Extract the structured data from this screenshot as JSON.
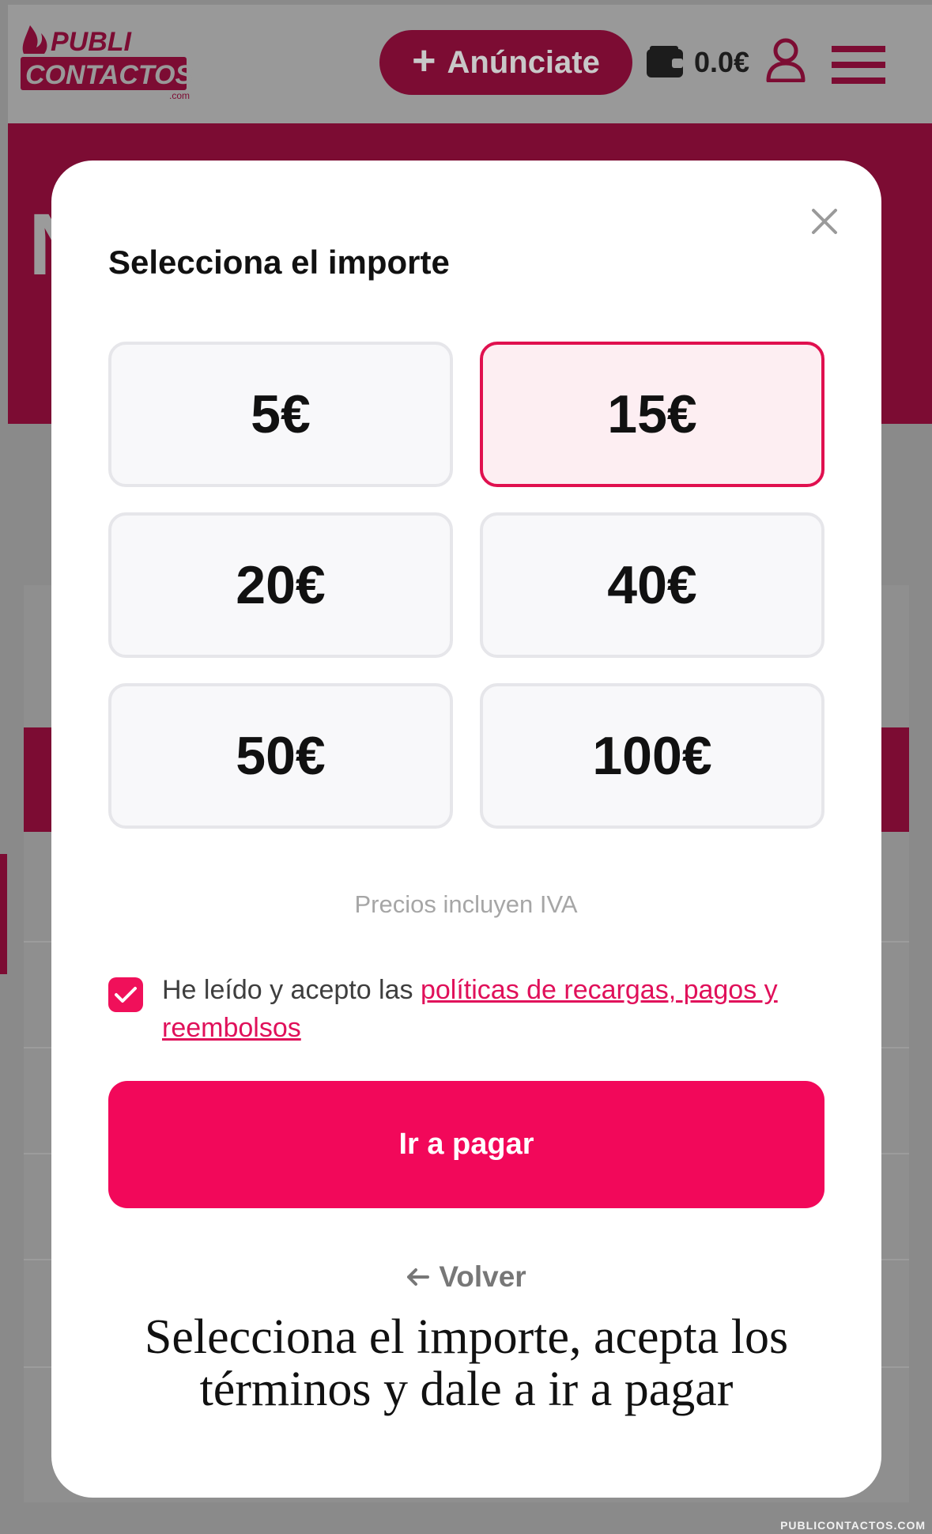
{
  "header": {
    "logo_line1": "PUBLI",
    "logo_line2": "CONTACTOS",
    "logo_suffix": ".com",
    "advertise_label": "Anúnciate",
    "wallet_balance": "0.0€"
  },
  "modal": {
    "title": "Selecciona el importe",
    "amounts": [
      "5€",
      "15€",
      "20€",
      "40€",
      "50€",
      "100€"
    ],
    "selected_amount": "15€",
    "price_note": "Precios incluyen IVA",
    "terms_prefix": "He leído y acepto las ",
    "terms_link": "políticas de recargas, pagos y reembolsos",
    "terms_checked": true,
    "pay_button": "Ir a pagar",
    "back_label": "Volver"
  },
  "caption": "Selecciona el importe, acepta los términos y dale a ir a pagar",
  "footer_credit": "PUBLICONTACTOS.COM",
  "colors": {
    "accent": "#f2085a",
    "brand_dark": "#7c0c33",
    "selected_bg": "#fdeef2"
  },
  "icons": {
    "advertise": "plus-icon",
    "wallet": "wallet-icon",
    "account": "user-icon",
    "menu": "hamburger-menu-icon",
    "close": "close-icon",
    "checkbox": "check-icon",
    "back": "arrow-left-icon"
  }
}
